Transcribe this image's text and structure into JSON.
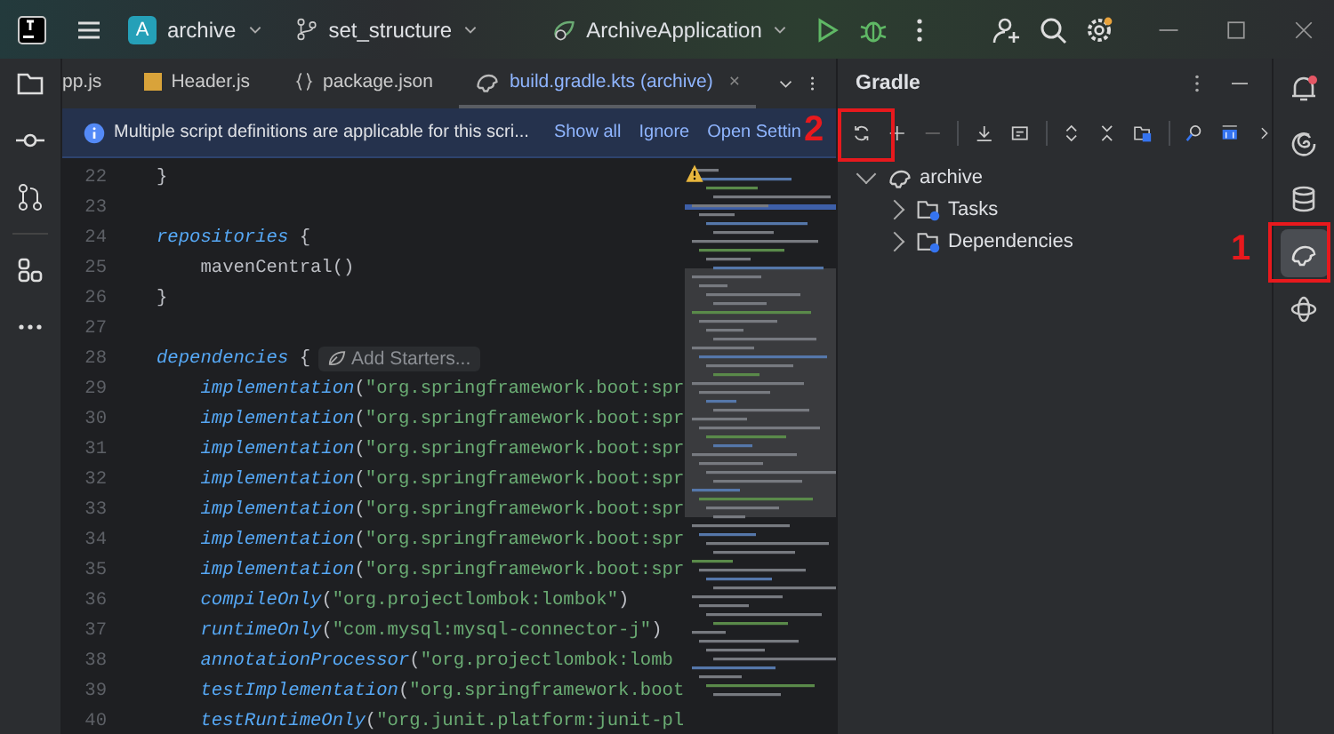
{
  "title_bar": {
    "project_initial": "A",
    "project": "archive",
    "branch": "set_structure",
    "run_config": "ArchiveApplication"
  },
  "editor": {
    "tabs": [
      {
        "label": "pp.js",
        "kind": "plain",
        "selected": false
      },
      {
        "label": "Header.js",
        "kind": "js",
        "selected": false
      },
      {
        "label": "package.json",
        "kind": "json",
        "selected": false
      },
      {
        "label": "build.gradle.kts (archive)",
        "kind": "gradle",
        "selected": true,
        "close": "×"
      }
    ],
    "notification": {
      "message": "Multiple script definitions are applicable for this scri...",
      "actions": [
        "Show all",
        "Ignore",
        "Open Settin"
      ]
    },
    "lines": [
      {
        "number": "22",
        "tokens": [
          {
            "kind": "plain",
            "text": "}"
          }
        ]
      },
      {
        "number": "23"
      },
      {
        "number": "24",
        "tokens": [
          {
            "kind": "keyword",
            "text": "repositories"
          },
          {
            "kind": "plain",
            "text": " {"
          }
        ]
      },
      {
        "number": "25",
        "tokens": [
          {
            "kind": "plain",
            "text": "    mavenCentral()"
          }
        ]
      },
      {
        "number": "26",
        "tokens": [
          {
            "kind": "plain",
            "text": "}"
          }
        ]
      },
      {
        "number": "27"
      },
      {
        "number": "28",
        "tokens": [
          {
            "kind": "keyword",
            "text": "dependencies"
          },
          {
            "kind": "plain",
            "text": " {"
          },
          {
            "kind": "hint",
            "text": "Add Starters..."
          }
        ]
      },
      {
        "number": "29",
        "tokens": [
          {
            "kind": "keyword",
            "text": "    implementation"
          },
          {
            "kind": "plain",
            "text": "("
          },
          {
            "kind": "string",
            "text": "\"org.springframework.boot:spr"
          }
        ]
      },
      {
        "number": "30",
        "tokens": [
          {
            "kind": "keyword",
            "text": "    implementation"
          },
          {
            "kind": "plain",
            "text": "("
          },
          {
            "kind": "string",
            "text": "\"org.springframework.boot:spr"
          }
        ]
      },
      {
        "number": "31",
        "tokens": [
          {
            "kind": "keyword",
            "text": "    implementation"
          },
          {
            "kind": "plain",
            "text": "("
          },
          {
            "kind": "string",
            "text": "\"org.springframework.boot:spr"
          }
        ]
      },
      {
        "number": "32",
        "tokens": [
          {
            "kind": "keyword",
            "text": "    implementation"
          },
          {
            "kind": "plain",
            "text": "("
          },
          {
            "kind": "string",
            "text": "\"org.springframework.boot:spr"
          }
        ]
      },
      {
        "number": "33",
        "tokens": [
          {
            "kind": "keyword",
            "text": "    implementation"
          },
          {
            "kind": "plain",
            "text": "("
          },
          {
            "kind": "string",
            "text": "\"org.springframework.boot:spr"
          }
        ]
      },
      {
        "number": "34",
        "tokens": [
          {
            "kind": "keyword",
            "text": "    implementation"
          },
          {
            "kind": "plain",
            "text": "("
          },
          {
            "kind": "string",
            "text": "\"org.springframework.boot:spr"
          }
        ]
      },
      {
        "number": "35",
        "tokens": [
          {
            "kind": "keyword",
            "text": "    implementation"
          },
          {
            "kind": "plain",
            "text": "("
          },
          {
            "kind": "string",
            "text": "\"org.springframework.boot:spr"
          }
        ]
      },
      {
        "number": "36",
        "tokens": [
          {
            "kind": "keyword",
            "text": "    compileOnly"
          },
          {
            "kind": "plain",
            "text": "("
          },
          {
            "kind": "string",
            "text": "\"org.projectlombok:lombok\""
          },
          {
            "kind": "plain",
            "text": ")"
          }
        ]
      },
      {
        "number": "37",
        "tokens": [
          {
            "kind": "keyword",
            "text": "    runtimeOnly"
          },
          {
            "kind": "plain",
            "text": "("
          },
          {
            "kind": "string",
            "text": "\"com.mysql:mysql-connector-j\""
          },
          {
            "kind": "plain",
            "text": ")"
          }
        ]
      },
      {
        "number": "38",
        "tokens": [
          {
            "kind": "keyword",
            "text": "    annotationProcessor"
          },
          {
            "kind": "plain",
            "text": "("
          },
          {
            "kind": "string",
            "text": "\"org.projectlombok:lomb"
          }
        ]
      },
      {
        "number": "39",
        "tokens": [
          {
            "kind": "keyword",
            "text": "    testImplementation"
          },
          {
            "kind": "plain",
            "text": "("
          },
          {
            "kind": "string",
            "text": "\"org.springframework.boot"
          }
        ]
      },
      {
        "number": "40",
        "tokens": [
          {
            "kind": "keyword",
            "text": "    testRuntimeOnly"
          },
          {
            "kind": "plain",
            "text": "("
          },
          {
            "kind": "string",
            "text": "\"org.junit.platform:junit-pl"
          }
        ]
      }
    ]
  },
  "gradle_panel": {
    "title": "Gradle",
    "tree": [
      {
        "label": "archive",
        "expanded": true,
        "children": [
          {
            "label": "Tasks",
            "expanded": false
          },
          {
            "label": "Dependencies",
            "expanded": false
          }
        ]
      }
    ]
  },
  "right_toolbar": [
    {
      "kind": "bell",
      "selected": false,
      "badge": true
    },
    {
      "kind": "spiral",
      "selected": false
    },
    {
      "kind": "database",
      "selected": false
    },
    {
      "kind": "gradle",
      "selected": true
    },
    {
      "kind": "orbit",
      "selected": false
    }
  ],
  "annotations": [
    {
      "text": "2"
    },
    {
      "text": "1"
    }
  ]
}
